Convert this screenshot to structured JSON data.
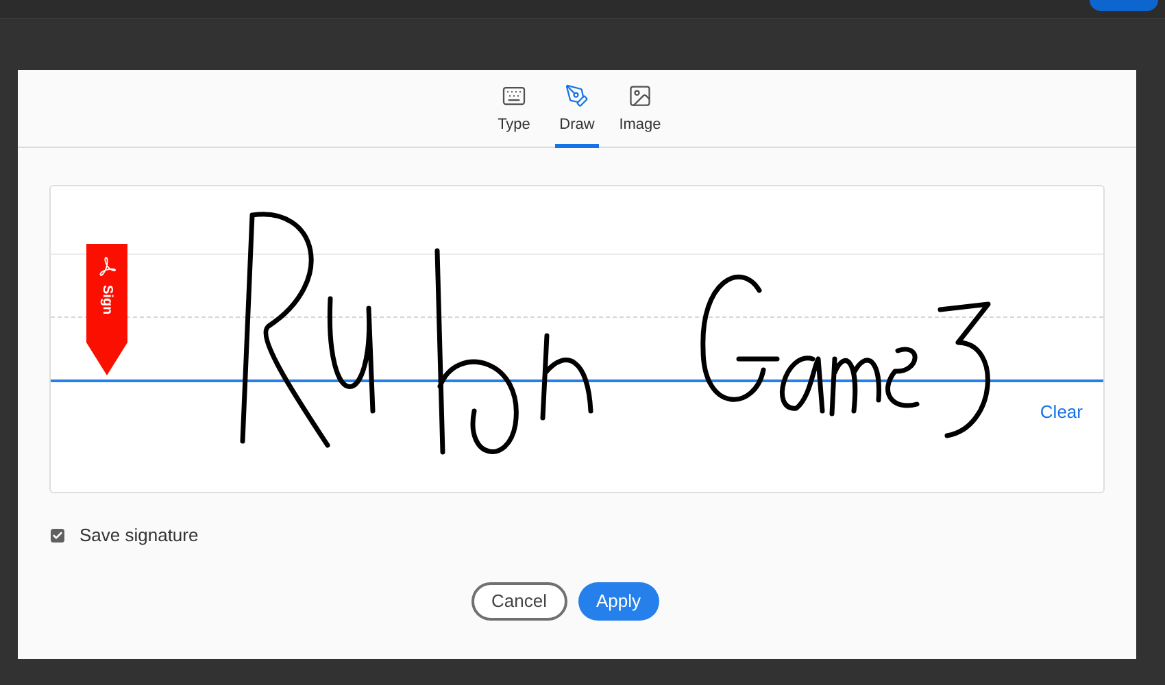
{
  "tabs": [
    {
      "label": "Type",
      "kind": "keyboard",
      "selected": false
    },
    {
      "label": "Draw",
      "kind": "pen",
      "selected": true
    },
    {
      "label": "Image",
      "kind": "image",
      "selected": false
    }
  ],
  "sign_flag": {
    "label": "Sign"
  },
  "clear_link": "Clear",
  "save_signature": {
    "label": "Save signature",
    "checked": true
  },
  "buttons": [
    {
      "label": "Cancel",
      "kind": "secondary"
    },
    {
      "label": "Apply",
      "kind": "primary"
    }
  ]
}
